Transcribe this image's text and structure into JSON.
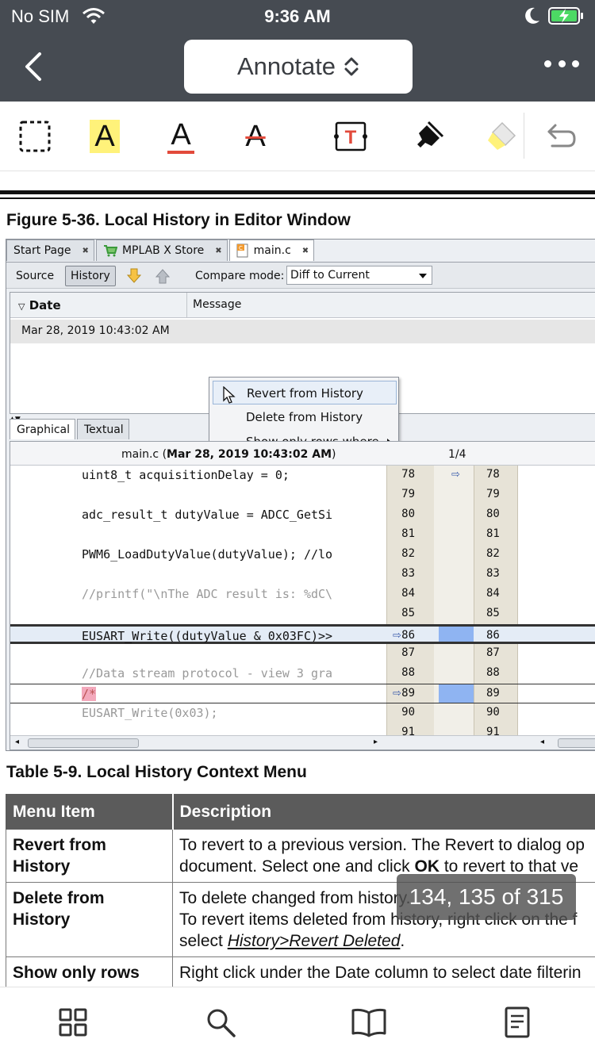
{
  "status_bar": {
    "carrier": "No SIM",
    "time": "9:36 AM"
  },
  "nav": {
    "title": "Annotate"
  },
  "toolbar": {
    "highlight_letter": "A",
    "underline_letter": "A",
    "strike_letter": "A",
    "textbox_letter": "T"
  },
  "document": {
    "figure_caption": "Figure 5-36.  Local History in Editor Window",
    "ide": {
      "tabs": [
        "Start Page",
        "MPLAB X Store",
        "main.c"
      ],
      "source_label": "Source",
      "history_label": "History",
      "compare_label": "Compare mode:",
      "compare_value": "Diff to Current",
      "col_date": "Date",
      "col_message": "Message",
      "row_date": "Mar 28, 2019 10:43:02 AM",
      "context_menu": [
        "Revert from History",
        "Delete from History",
        "Show only rows where"
      ],
      "bottom_tabs": [
        "Graphical",
        "Textual"
      ],
      "diff_file": "main.c (",
      "diff_file_date": "Mar 28, 2019 10:43:02 AM",
      "diff_file_end": ")",
      "diff_position": "1/4",
      "code_lines": [
        {
          "text": "uint8_t acquisitionDelay = 0;",
          "ln": "78",
          "rn": "78"
        },
        {
          "text": "",
          "ln": "79",
          "rn": "79"
        },
        {
          "text": "adc_result_t dutyValue = ADCC_GetSi",
          "ln": "80",
          "rn": "80"
        },
        {
          "text": "",
          "ln": "81",
          "rn": "81"
        },
        {
          "text": "PWM6_LoadDutyValue(dutyValue); //lo",
          "ln": "82",
          "rn": "82"
        },
        {
          "text": "",
          "ln": "83",
          "rn": "83"
        },
        {
          "text": "//printf(\"\\nThe ADC result is: %dC\\",
          "ln": "84",
          "rn": "84"
        },
        {
          "text": "",
          "ln": "85",
          "rn": "85"
        },
        {
          "text": "EUSART_Write((dutyValue & 0x03FC)>>",
          "ln": "86",
          "rn": "86"
        },
        {
          "text": "",
          "ln": "87",
          "rn": "87"
        },
        {
          "text": "//Data stream protocol - view 3 gra",
          "ln": "88",
          "rn": "88"
        },
        {
          "text": "/*",
          "ln": "89",
          "rn": "89"
        },
        {
          "text": "EUSART_Write(0x03);",
          "ln": "90",
          "rn": "90"
        },
        {
          "text": "",
          "ln": "91",
          "rn": "91"
        }
      ]
    },
    "table_caption": "Table 5-9.  Local History Context Menu",
    "table": {
      "headers": [
        "Menu Item",
        "Description"
      ],
      "rows": [
        {
          "item": "Revert from History",
          "lines": [
            "To revert to a previous version. The Revert to dialog op",
            "document. Select one and click ",
            "OK",
            " to revert to that ve"
          ]
        },
        {
          "item": "Delete from History",
          "lines": [
            "To delete changed from history.",
            "To revert items deleted from history, right click on the f",
            "select ",
            "History>Revert Deleted",
            "."
          ]
        },
        {
          "item": "Show only rows",
          "lines": [
            "Right click under the Date column to select date filterin"
          ]
        }
      ]
    },
    "page_indicator": "134, 135 of 315"
  }
}
